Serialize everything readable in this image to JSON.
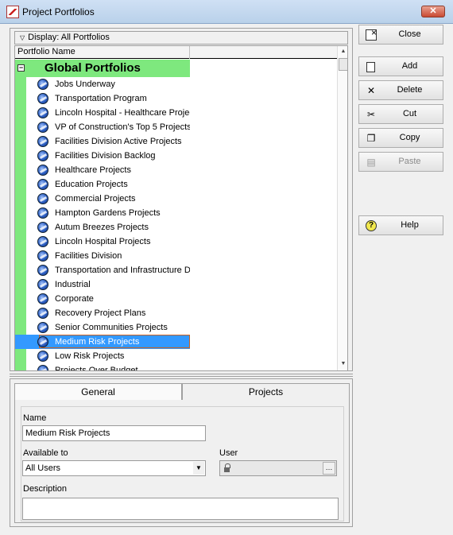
{
  "window": {
    "title": "Project Portfolios",
    "close_glyph": "✕"
  },
  "list": {
    "display_label": "Display: All Portfolios",
    "column_header": "Portfolio Name",
    "group": {
      "expander": "−",
      "label": "Global Portfolios"
    },
    "items": [
      "Jobs Underway",
      "Transportation Program",
      "Lincoln Hospital - Healthcare Projects",
      "VP of Construction's Top 5 Projects",
      "Facilities Division Active Projects",
      "Facilities Division Backlog",
      "Healthcare Projects",
      "Education Projects",
      "Commercial Projects",
      "Hampton Gardens Projects",
      "Autum Breezes Projects",
      "Lincoln Hospital Projects",
      "Facilities Division",
      "Transportation and Infrastructure Division",
      "Industrial",
      "Corporate",
      "Recovery Project Plans",
      "Senior Communities Projects",
      "Medium Risk Projects",
      "Low Risk Projects",
      "Projects Over Budget"
    ],
    "selected_index": 18
  },
  "tabs": {
    "general": "General",
    "projects": "Projects",
    "active": "General"
  },
  "form": {
    "name_label": "Name",
    "name_value": "Medium Risk Projects",
    "available_label": "Available to",
    "available_value": "All Users",
    "user_label": "User",
    "user_value": "",
    "description_label": "Description",
    "description_value": ""
  },
  "buttons": {
    "close": "Close",
    "add": "Add",
    "delete": "Delete",
    "cut": "Cut",
    "copy": "Copy",
    "paste": "Paste",
    "help": "Help"
  },
  "colors": {
    "group_green": "#7ee87e",
    "selection_blue": "#3399ff"
  }
}
